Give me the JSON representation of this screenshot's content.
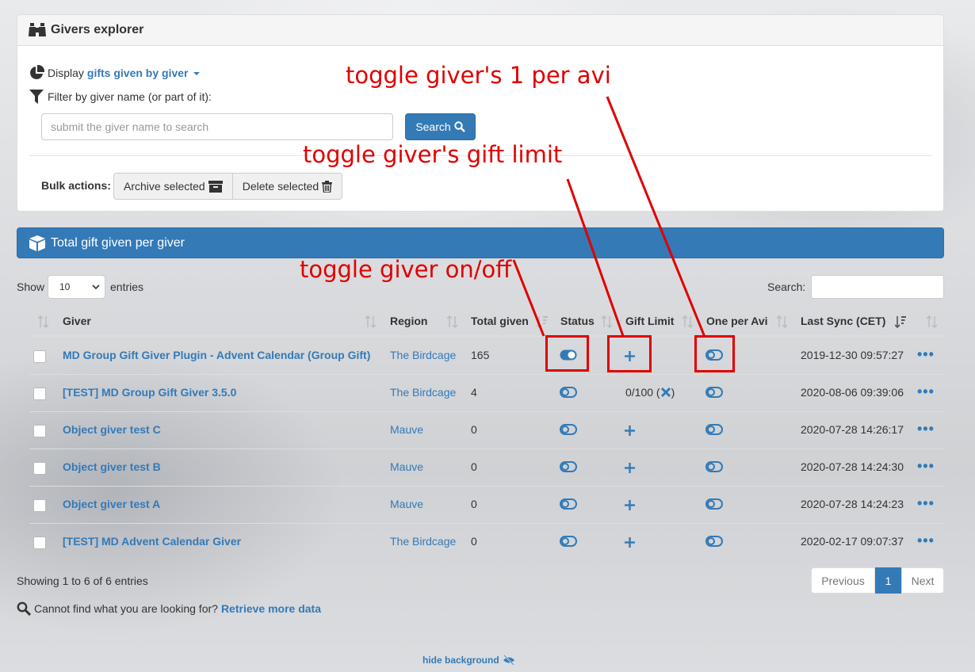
{
  "panel_top": {
    "title": "Givers explorer",
    "display_label": "Display",
    "display_value": "gifts given by giver",
    "filter_label": "Filter by giver name (or part of it):",
    "search_placeholder": "submit the giver name to search",
    "search_button": "Search",
    "bulk_label": "Bulk actions:",
    "archive_label": "Archive selected",
    "delete_label": "Delete selected"
  },
  "panel_table": {
    "title": "Total gift given per giver"
  },
  "table_controls": {
    "show_label": "Show",
    "entries_value": "10",
    "entries_label": "entries",
    "search_label": "Search:"
  },
  "columns": [
    "Giver",
    "Region",
    "Total given",
    "Status",
    "Gift Limit",
    "One per Avi",
    "Last Sync (CET)"
  ],
  "rows": [
    {
      "giver": "MD Group Gift Giver Plugin - Advent Calendar (Group Gift)",
      "region": "The Birdcage",
      "total": "165",
      "status_on": true,
      "gift_limit": "+",
      "last_sync": "2019-12-30 09:57:27"
    },
    {
      "giver": "[TEST] MD Group Gift Giver 3.5.0",
      "region": "The Birdcage",
      "total": "4",
      "status_on": false,
      "gift_limit": "0/100 (",
      "gift_limit_close": ")",
      "last_sync": "2020-08-06 09:39:06"
    },
    {
      "giver": "Object giver test C",
      "region": "Mauve",
      "total": "0",
      "status_on": false,
      "gift_limit": "+",
      "last_sync": "2020-07-28 14:26:17"
    },
    {
      "giver": "Object giver test B",
      "region": "Mauve",
      "total": "0",
      "status_on": false,
      "gift_limit": "+",
      "last_sync": "2020-07-28 14:24:30"
    },
    {
      "giver": "Object giver test A",
      "region": "Mauve",
      "total": "0",
      "status_on": false,
      "gift_limit": "+",
      "last_sync": "2020-07-28 14:24:23"
    },
    {
      "giver": "[TEST] MD Advent Calendar Giver",
      "region": "The Birdcage",
      "total": "0",
      "status_on": false,
      "gift_limit": "+",
      "last_sync": "2020-02-17 09:07:37"
    }
  ],
  "row_actions": "•••",
  "footer": {
    "showing": "Showing 1 to 6 of 6 entries",
    "previous": "Previous",
    "page": "1",
    "next": "Next",
    "cant_find": "Cannot find what you are looking for?",
    "retrieve": "Retrieve more data",
    "hide_background": "hide background"
  },
  "annotations": {
    "one_per_avi": "toggle giver's 1 per avi",
    "gift_limit": "toggle giver's gift limit",
    "on_off": "toggle giver on/off"
  },
  "colors": {
    "primary": "#337ab7",
    "annotation": "#e00000"
  },
  "icons": [
    "binoculars-icon",
    "pie-chart-icon",
    "filter-icon",
    "search-icon",
    "archive-icon",
    "trash-icon",
    "cube-icon",
    "sort-icon",
    "toggle-on-icon",
    "toggle-off-icon",
    "plus-icon",
    "close-icon",
    "ellipsis-icon",
    "eye-slash-icon"
  ]
}
